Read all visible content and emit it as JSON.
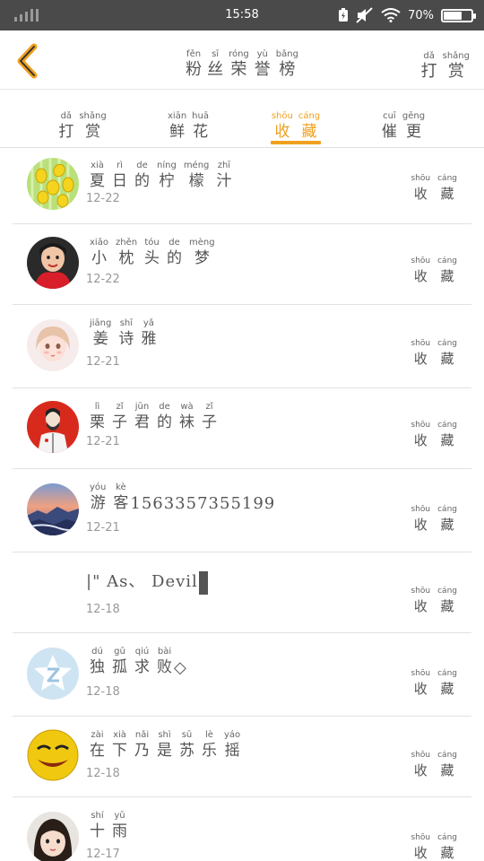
{
  "status_bar": {
    "time": "15:58",
    "battery_percent": "70%",
    "battery_level": 0.7,
    "icons": [
      "signal-icon",
      "battery-saver-icon",
      "mute-icon",
      "wifi-icon",
      "battery-icon"
    ]
  },
  "header": {
    "back_icon": "chevron-left-icon",
    "accent_color": "#f0a01e",
    "title": [
      {
        "py": "fěn",
        "hz": "粉"
      },
      {
        "py": "sī",
        "hz": "丝"
      },
      {
        "py": "róng",
        "hz": "荣"
      },
      {
        "py": "yù",
        "hz": "誉"
      },
      {
        "py": "bǎng",
        "hz": "榜"
      }
    ],
    "right_action": [
      {
        "py": "dǎ",
        "hz": "打"
      },
      {
        "py": "shǎng",
        "hz": "赏"
      }
    ]
  },
  "tabs": [
    {
      "chars": [
        {
          "py": "dǎ",
          "hz": "打"
        },
        {
          "py": "shǎng",
          "hz": "赏"
        }
      ],
      "active": false
    },
    {
      "chars": [
        {
          "py": "xiān",
          "hz": "鲜"
        },
        {
          "py": "huā",
          "hz": "花"
        }
      ],
      "active": false
    },
    {
      "chars": [
        {
          "py": "shōu",
          "hz": "收"
        },
        {
          "py": "cáng",
          "hz": "藏"
        }
      ],
      "active": true
    },
    {
      "chars": [
        {
          "py": "cuī",
          "hz": "催"
        },
        {
          "py": "gēng",
          "hz": "更"
        }
      ],
      "active": false
    }
  ],
  "list": [
    {
      "name": [
        {
          "py": "xià",
          "hz": "夏"
        },
        {
          "py": "rì",
          "hz": "日"
        },
        {
          "py": "de",
          "hz": "的"
        },
        {
          "py": "níng",
          "hz": "柠"
        },
        {
          "py": "méng",
          "hz": "檬"
        },
        {
          "py": "zhī",
          "hz": "汁"
        }
      ],
      "date": "12-22",
      "action": [
        {
          "py": "shōu",
          "hz": "收"
        },
        {
          "py": "cáng",
          "hz": "藏"
        }
      ],
      "avatar": "lemon-avatar"
    },
    {
      "name": [
        {
          "py": "xiǎo",
          "hz": "小"
        },
        {
          "py": "zhěn",
          "hz": "枕"
        },
        {
          "py": "tóu",
          "hz": "头"
        },
        {
          "py": "de",
          "hz": "的"
        },
        {
          "py": "mèng",
          "hz": "梦"
        }
      ],
      "date": "12-22",
      "action": [
        {
          "py": "shōu",
          "hz": "收"
        },
        {
          "py": "cáng",
          "hz": "藏"
        }
      ],
      "avatar": "girl-red-scarf-avatar"
    },
    {
      "name": [
        {
          "py": "jiāng",
          "hz": "姜"
        },
        {
          "py": "shī",
          "hz": "诗"
        },
        {
          "py": "yǎ",
          "hz": "雅"
        }
      ],
      "date": "12-21",
      "action": [
        {
          "py": "shōu",
          "hz": "收"
        },
        {
          "py": "cáng",
          "hz": "藏"
        }
      ],
      "avatar": "anime-girl-avatar"
    },
    {
      "name": [
        {
          "py": "lì",
          "hz": "栗"
        },
        {
          "py": "zǐ",
          "hz": "子"
        },
        {
          "py": "jūn",
          "hz": "君"
        },
        {
          "py": "de",
          "hz": "的"
        },
        {
          "py": "wà",
          "hz": "袜"
        },
        {
          "py": "zǐ",
          "hz": "子"
        }
      ],
      "date": "12-21",
      "action": [
        {
          "py": "shōu",
          "hz": "收"
        },
        {
          "py": "cáng",
          "hz": "藏"
        }
      ],
      "avatar": "man-red-background-avatar"
    },
    {
      "name": [
        {
          "py": "yóu",
          "hz": "游"
        },
        {
          "py": "kè",
          "hz": "客"
        }
      ],
      "name_suffix": "1563357355199",
      "date": "12-21",
      "action": [
        {
          "py": "shōu",
          "hz": "收"
        },
        {
          "py": "cáng",
          "hz": "藏"
        }
      ],
      "avatar": "sunset-landscape-avatar"
    },
    {
      "name": [],
      "name_text": "|\" As、 Devil",
      "date": "12-18",
      "action": [
        {
          "py": "shōu",
          "hz": "收"
        },
        {
          "py": "cáng",
          "hz": "藏"
        }
      ],
      "avatar": "no-avatar"
    },
    {
      "name": [
        {
          "py": "dú",
          "hz": "独"
        },
        {
          "py": "gū",
          "hz": "孤"
        },
        {
          "py": "qiú",
          "hz": "求"
        },
        {
          "py": "bài",
          "hz": "败"
        }
      ],
      "name_suffix": "◇",
      "date": "12-18",
      "action": [
        {
          "py": "shōu",
          "hz": "收"
        },
        {
          "py": "cáng",
          "hz": "藏"
        }
      ],
      "avatar": "default-star-avatar"
    },
    {
      "name": [
        {
          "py": "zài",
          "hz": "在"
        },
        {
          "py": "xià",
          "hz": "下"
        },
        {
          "py": "nǎi",
          "hz": "乃"
        },
        {
          "py": "shì",
          "hz": "是"
        },
        {
          "py": "sū",
          "hz": "苏"
        },
        {
          "py": "lè",
          "hz": "乐"
        },
        {
          "py": "yáo",
          "hz": "摇"
        }
      ],
      "date": "12-18",
      "action": [
        {
          "py": "shōu",
          "hz": "收"
        },
        {
          "py": "cáng",
          "hz": "藏"
        }
      ],
      "avatar": "smiley-face-avatar"
    },
    {
      "name": [
        {
          "py": "shí",
          "hz": "十"
        },
        {
          "py": "yǔ",
          "hz": "雨"
        }
      ],
      "date": "12-17",
      "action": [
        {
          "py": "shōu",
          "hz": "收"
        },
        {
          "py": "cáng",
          "hz": "藏"
        }
      ],
      "avatar": "little-girl-avatar"
    }
  ]
}
